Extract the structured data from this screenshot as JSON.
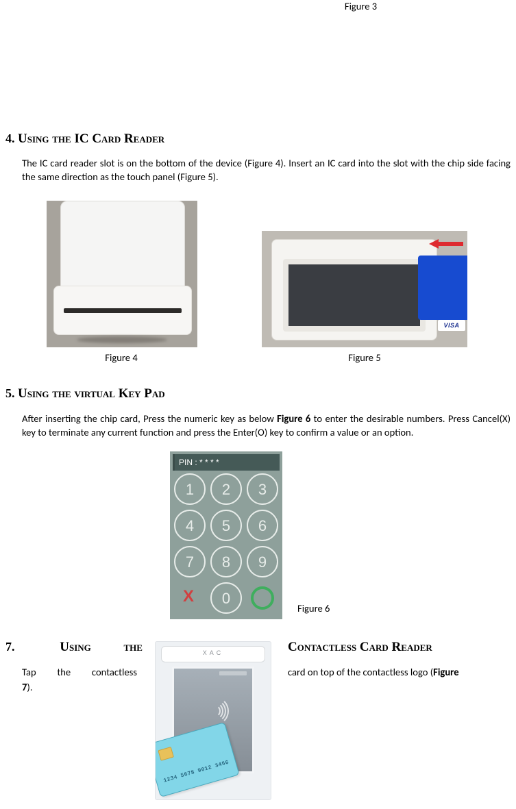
{
  "fig3_caption": "Figure 3",
  "section4": {
    "num": "4.",
    "title": "Using the IC Card Reader",
    "para": "The IC card reader slot is on the bottom of the device (Figure 4). Insert an IC card into the slot with the chip side facing the same direction as the touch panel (Figure 5).",
    "fig4_caption": "Figure 4",
    "fig5_caption": "Figure 5",
    "visa_label": "VISA"
  },
  "section5": {
    "num": "5.",
    "title": "Using the virtual Key Pad",
    "para_pre": "After inserting the chip card, Press the numeric key as below ",
    "para_bold": "Figure 6",
    "para_post": " to enter the desirable numbers. Press Cancel(X) key to terminate any current function and press the Enter(O) key to confirm a value or an option.",
    "fig6_caption": "Figure 6",
    "keypad": {
      "pin_label": "PIN : * * * *",
      "keys": [
        "1",
        "2",
        "3",
        "4",
        "5",
        "6",
        "7",
        "8",
        "9",
        "X",
        "0",
        "O"
      ]
    }
  },
  "section7": {
    "num": "7.",
    "left_head_a": "Using",
    "left_head_b": "the",
    "right_head": "Contactless Card Reader",
    "left_text_a": "Tap the contactless",
    "left_text_b": "7",
    "left_text_c": ").",
    "right_text_a": "card on top of the contactless logo (",
    "right_bold": "Figure",
    "device_brand": "XAC",
    "card_number": "1234 5678 9012 3456"
  }
}
